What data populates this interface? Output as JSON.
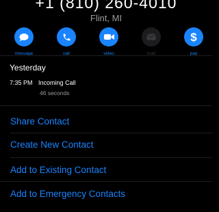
{
  "contact": {
    "phone_number": "+1 (810) 260-4010",
    "location": "Flint, MI"
  },
  "actions": [
    {
      "label": "message",
      "icon": "message-icon",
      "enabled": true
    },
    {
      "label": "call",
      "icon": "phone-icon",
      "enabled": true
    },
    {
      "label": "video",
      "icon": "video-icon",
      "enabled": true
    },
    {
      "label": "mail",
      "icon": "mail-icon",
      "enabled": false
    },
    {
      "label": "pay",
      "icon": "dollar-icon",
      "enabled": true
    }
  ],
  "recent": {
    "date": "Yesterday",
    "time": "7:35 PM",
    "type": "Incoming Call",
    "duration": "46 seconds"
  },
  "menu": {
    "share_contact": "Share Contact",
    "create_new_contact": "Create New Contact",
    "add_to_existing_contact": "Add to Existing Contact",
    "add_to_emergency_contacts": "Add to Emergency Contacts"
  },
  "colors": {
    "accent": "#1a84ff",
    "background": "#000000",
    "secondary_text": "#9b9b9f",
    "disabled_button": "#1c1c1e"
  }
}
